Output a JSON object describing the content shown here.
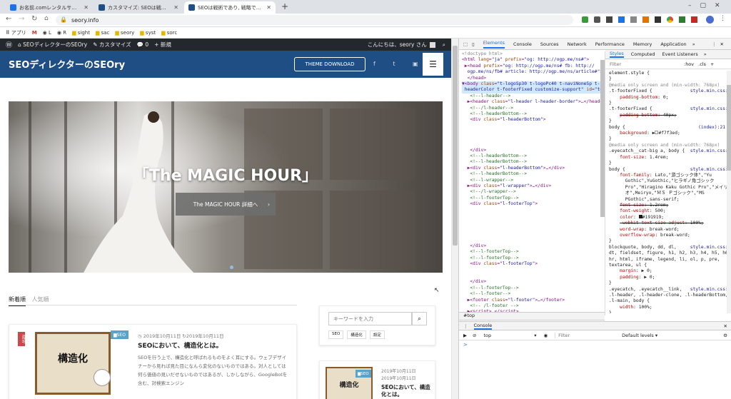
{
  "browser": {
    "tabs": [
      {
        "title": "お名前.comレンタルサーバー コントロ…",
        "active": false,
        "fav": "#1b73e8"
      },
      {
        "title": "カスタマイズ: SEOは戦術であり, 戦略…",
        "active": false,
        "fav": "#1f4e84"
      },
      {
        "title": "SEOは戦術であり, 戦略ではない。",
        "active": true,
        "fav": "#1f4e84"
      }
    ],
    "new_tab": "+",
    "url": "seory.info",
    "bookmarks": [
      "アプリ",
      "M",
      "L",
      "R",
      "sight",
      "sac",
      "seory",
      "syst",
      "sorc"
    ]
  },
  "wpbar": {
    "site": "SEOディレクターのSEOry",
    "customize": "カスタマイズ",
    "comments": "0",
    "new": "+ 新規",
    "greeting": "こんにちは、seory さん"
  },
  "site": {
    "logo": "SEOディレクターのSEOry",
    "download": "THEME DOWNLOAD",
    "hero_title": "「The MAGIC HOUR」",
    "hero_button": "The MAGIC HOUR 詳細へ",
    "tab_new": "新着順",
    "tab_popular": "人気順",
    "search_placeholder": "キーワードを入力",
    "tags": [
      "SEO",
      "構造化",
      "設定"
    ],
    "post": {
      "badge": "NEW",
      "thumb_text": "構造化",
      "category": "SEO",
      "date": "2019年10月11日",
      "updated": "2019年10月11日",
      "title": "SEOにおいて、構造化とは。",
      "excerpt": "SEOを行う上で、構造化と呼ばれるものをよく耳にする。ウェブデザイナーから見れば見た目になんら変化のないものではある。対人としては何ら価値の見いだせないものではあるが、しかしながら、GoogleBotを含む、対検索エンジン"
    },
    "side_post": {
      "thumb_text": "構造化",
      "category": "SEO",
      "date": "2019年10月11日",
      "updated": "2019年10月11日",
      "title": "SEOにおいて、構造化とは。"
    }
  },
  "devtools": {
    "tabs": [
      "Elements",
      "Console",
      "Sources",
      "Network",
      "Performance",
      "Memory",
      "Application"
    ],
    "active_tab": "Elements",
    "styles_tabs": [
      "Styles",
      "Computed",
      "Event Listeners"
    ],
    "filter_placeholder": "Filter",
    "hov": ":hov",
    "cls": ".cls",
    "breadcrumb": "#top",
    "drawer_tab": "Console",
    "context": "top",
    "console_filter": "Filter",
    "levels": "Default levels ▾",
    "prompt": ">"
  }
}
